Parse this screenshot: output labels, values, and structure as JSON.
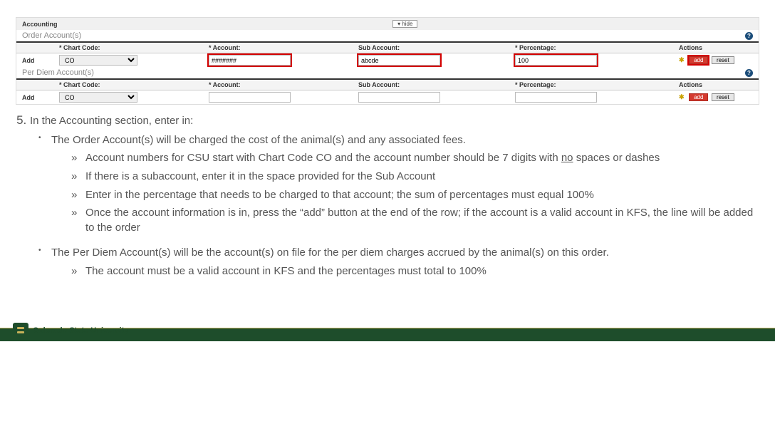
{
  "panel": {
    "title": "Accounting",
    "hide_label": "▾ hide"
  },
  "order": {
    "section_label": "Order Account(s)",
    "headers": {
      "chart": "Chart Code:",
      "account": "Account:",
      "sub": "Sub Account:",
      "pct": "Percentage:",
      "actions": "Actions"
    },
    "row": {
      "add_label": "Add",
      "chart_value": "CO",
      "account_value": "#######",
      "sub_value": "abcde",
      "pct_value": "100",
      "btn_add": "add",
      "btn_reset": "reset"
    }
  },
  "perdiem": {
    "section_label": "Per Diem Account(s)",
    "headers": {
      "chart": "Chart Code:",
      "account": "Account:",
      "sub": "Sub Account:",
      "pct": "Percentage:",
      "actions": "Actions"
    },
    "row": {
      "add_label": "Add",
      "chart_value": "CO",
      "account_value": "",
      "sub_value": "",
      "pct_value": "",
      "btn_add": "add",
      "btn_reset": "reset"
    }
  },
  "instr": {
    "heading": "In the Accounting section, enter in:",
    "order_intro": "The Order Account(s) will be charged the cost of the animal(s) and any associated fees.",
    "order_b1a": "Account numbers for CSU start with Chart Code CO and the account number should be 7 digits with ",
    "order_b1_no": "no",
    "order_b1b": " spaces or dashes",
    "order_b2": "If there is a subaccount, enter it in the space provided for the Sub Account",
    "order_b3": "Enter in the percentage that needs to be charged to that account; the sum of percentages must equal 100%",
    "order_b4": "Once the account information is in, press the “add” button at the end of the row; if the account is a valid account in KFS, the line will be added to the order",
    "perdiem_intro": "The Per Diem Account(s) will be the account(s) on file for the per diem charges accrued by the animal(s) on this order.",
    "perdiem_b1": "The account must be a valid account in KFS and the percentages must total to 100%"
  },
  "footer": {
    "uni": "Colorado State University"
  }
}
